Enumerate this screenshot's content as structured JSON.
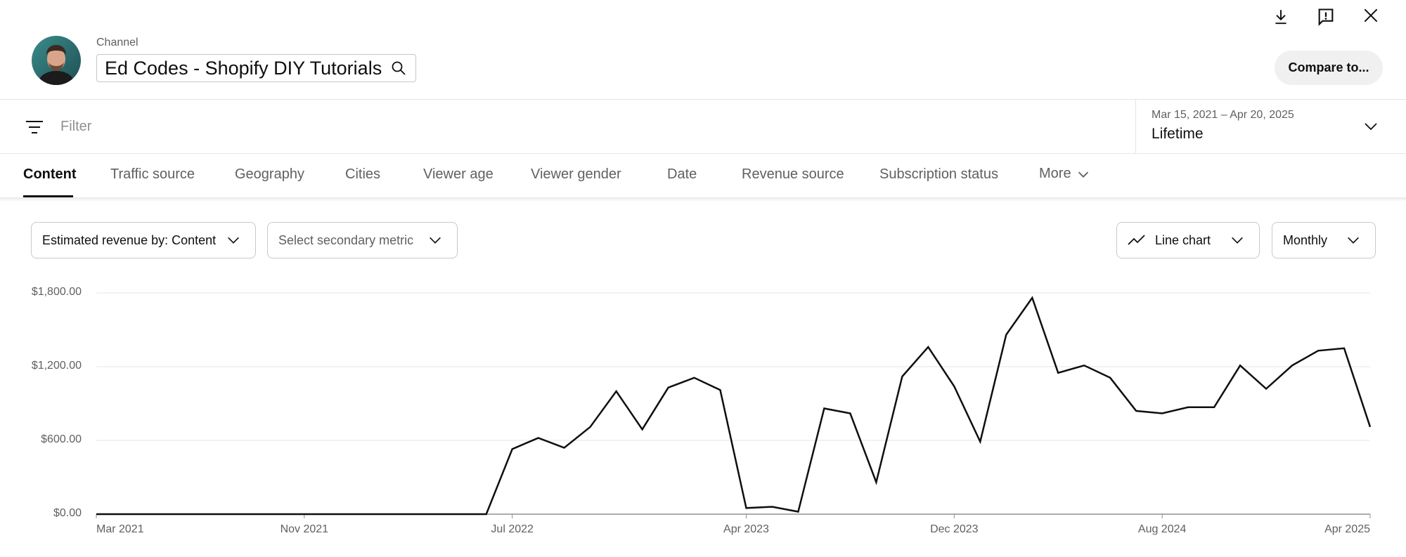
{
  "header": {
    "channel_label": "Channel",
    "channel_name": "Ed Codes - Shopify DIY Tutorials",
    "compare_label": "Compare to...",
    "icons": [
      "download-icon",
      "feedback-icon",
      "close-icon",
      "search-icon"
    ]
  },
  "filter": {
    "placeholder": "Filter",
    "date_range": "Mar 15, 2021 – Apr 20, 2025",
    "date_period": "Lifetime"
  },
  "tabs": [
    {
      "label": "Content",
      "active": true
    },
    {
      "label": "Traffic source"
    },
    {
      "label": "Geography"
    },
    {
      "label": "Cities"
    },
    {
      "label": "Viewer age"
    },
    {
      "label": "Viewer gender"
    },
    {
      "label": "Date"
    },
    {
      "label": "Revenue source"
    },
    {
      "label": "Subscription status"
    },
    {
      "label": "More"
    }
  ],
  "controls": {
    "primary_metric": "Estimated revenue by: Content",
    "secondary_metric_placeholder": "Select secondary metric",
    "chart_type": "Line chart",
    "granularity": "Monthly"
  },
  "chart_data": {
    "type": "line",
    "title": "",
    "xlabel": "",
    "ylabel": "",
    "ylim": [
      0,
      1800
    ],
    "y_ticks": [
      "$0.00",
      "$600.00",
      "$1,200.00",
      "$1,800.00"
    ],
    "y_tick_values": [
      0,
      600,
      1200,
      1800
    ],
    "x_ticks": [
      "Mar 2021",
      "Nov 2021",
      "Jul 2022",
      "Apr 2023",
      "Dec 2023",
      "Aug 2024",
      "Apr 2025"
    ],
    "x_tick_values": [
      "2021-03",
      "2021-11",
      "2022-07",
      "2023-04",
      "2023-12",
      "2024-08",
      "2025-04"
    ],
    "grid": true,
    "color": "#0f0f0f",
    "series": [
      {
        "x": [
          "2021-03",
          "2021-04",
          "2021-05",
          "2021-06",
          "2021-07",
          "2021-08",
          "2021-09",
          "2021-10",
          "2021-11",
          "2021-12",
          "2022-01",
          "2022-02",
          "2022-03",
          "2022-04",
          "2022-05",
          "2022-06",
          "2022-07",
          "2022-08",
          "2022-09",
          "2022-10",
          "2022-11",
          "2022-12",
          "2023-01",
          "2023-02",
          "2023-03",
          "2023-04",
          "2023-05",
          "2023-06",
          "2023-07",
          "2023-08",
          "2023-09",
          "2023-10",
          "2023-11",
          "2023-12",
          "2024-01",
          "2024-02",
          "2024-03",
          "2024-04",
          "2024-05",
          "2024-06",
          "2024-07",
          "2024-08",
          "2024-09",
          "2024-10",
          "2024-11",
          "2024-12",
          "2025-01",
          "2025-02",
          "2025-03",
          "2025-04"
        ],
        "values": [
          0,
          0,
          0,
          0,
          0,
          0,
          0,
          0,
          0,
          0,
          0,
          0,
          0,
          0,
          0,
          0,
          530,
          620,
          540,
          710,
          1000,
          690,
          1030,
          1110,
          1010,
          50,
          60,
          20,
          860,
          820,
          260,
          1120,
          1360,
          1040,
          590,
          1460,
          1760,
          1150,
          1210,
          1110,
          840,
          820,
          870,
          870,
          1210,
          1020,
          1210,
          1330,
          1350,
          710
        ]
      }
    ]
  }
}
